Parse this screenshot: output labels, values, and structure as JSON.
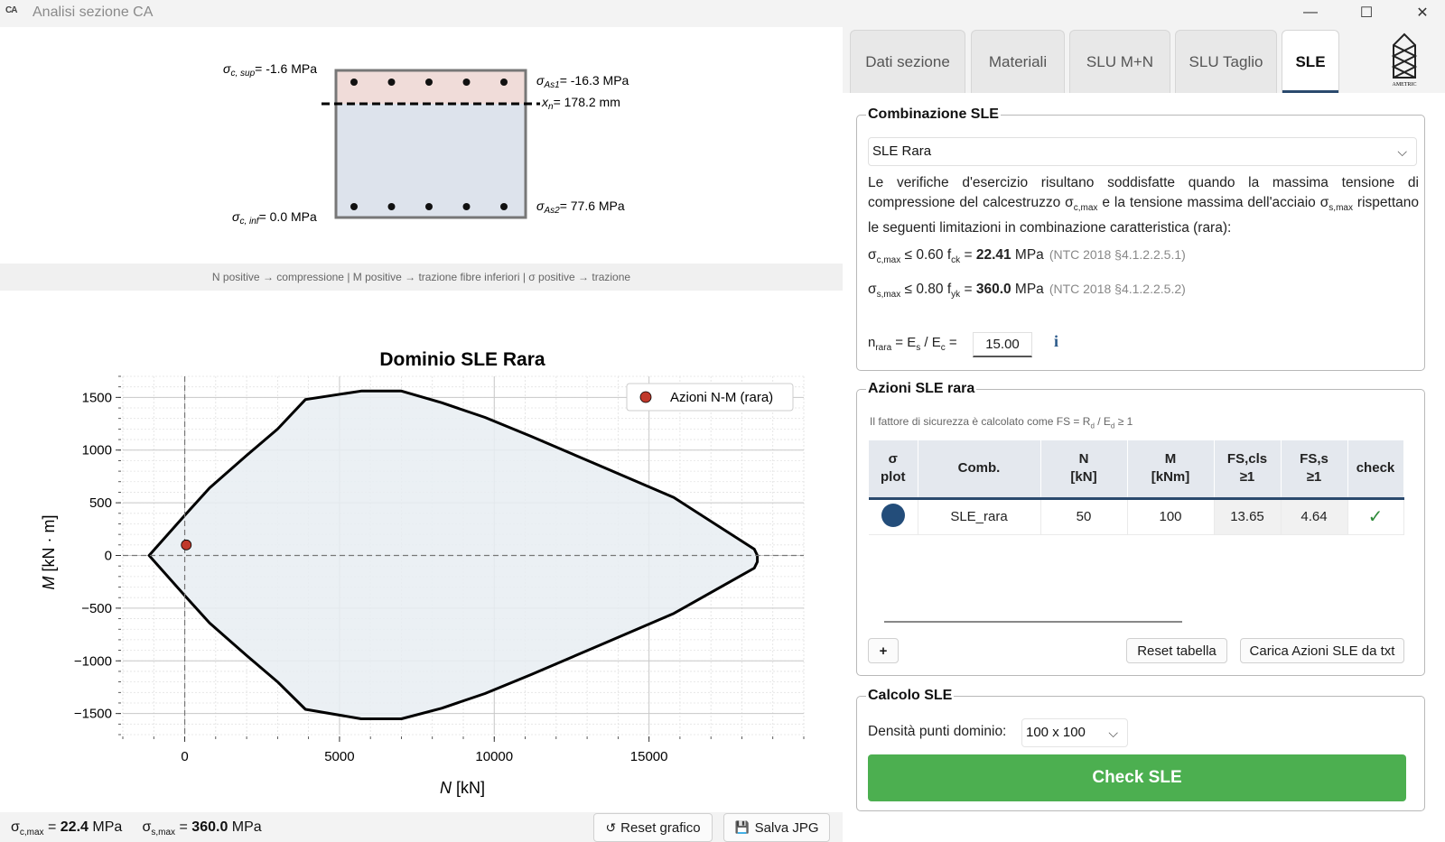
{
  "window": {
    "app_icon": "CA",
    "title": "Analisi sezione CA",
    "minimize": "—",
    "maximize": "☐",
    "close": "✕"
  },
  "section": {
    "sigma_c_sup": "= -1.6 MPa",
    "sigma_c_inf": "= 0.0 MPa",
    "sigma_As1": "= -16.3 MPa",
    "sigma_As2": "= 77.6 MPa",
    "xn": "= 178.2 mm",
    "neutral_axis_depth_fraction": 0.23,
    "top_bars": 5,
    "bottom_bars": 5,
    "colors": {
      "compression": "#f0dcd9",
      "tension": "#dde3ec",
      "border": "#777777"
    }
  },
  "convention": "N positive → compressione  |  M positive → trazione fibre inferiori  |  σ positive → trazione",
  "chart_data": {
    "type": "area",
    "title": "Dominio SLE Rara",
    "xlabel": "N [kN]",
    "ylabel": "M [kN · m]",
    "xlim": [
      -2000,
      20000
    ],
    "ylim": [
      -1700,
      1700
    ],
    "xticks": [
      0,
      5000,
      10000,
      15000
    ],
    "xtick_labels": [
      "0",
      "5000",
      "10000",
      "15000"
    ],
    "yticks": [
      1500,
      1000,
      500,
      0,
      -500,
      -1000,
      -1500
    ],
    "ytick_labels": [
      "1500",
      "1000",
      "500",
      "0",
      "−500",
      "−1000",
      "−1500"
    ],
    "grid": true,
    "legend_position": "top-right",
    "domain_boundary": {
      "x": [
        -1150,
        0,
        800,
        2000,
        3000,
        3900,
        5700,
        7000,
        8300,
        9700,
        11200,
        13500,
        15800,
        18400,
        18500,
        18500,
        18400,
        15800,
        13500,
        11200,
        9700,
        8300,
        7000,
        5700,
        3900,
        3000,
        2000,
        800,
        0,
        -1150
      ],
      "y": [
        0,
        380,
        640,
        950,
        1200,
        1480,
        1560,
        1560,
        1450,
        1310,
        1130,
        840,
        550,
        60,
        0,
        -60,
        -120,
        -550,
        -840,
        -1130,
        -1310,
        -1450,
        -1550,
        -1550,
        -1460,
        -1200,
        -950,
        -640,
        -380,
        0
      ]
    },
    "series": [
      {
        "name": "Azioni N-M (rara)",
        "type": "scatter",
        "points": [
          {
            "x": 50,
            "y": 100
          }
        ]
      }
    ],
    "colors": {
      "fill": "#e8edf2",
      "line": "#000000",
      "point": "#c0392b"
    }
  },
  "status": {
    "sigma_c_label": "σ",
    "sigma_c_sub": "c,max",
    "sigma_c_value": "22.4",
    "sigma_s_label": "σ",
    "sigma_s_sub": "s,max",
    "sigma_s_value": "360.0",
    "unit": "MPa",
    "reset_label": "Reset grafico",
    "reset_icon": "↺",
    "save_label": "Salva JPG",
    "save_icon": "💾"
  },
  "tabs": [
    {
      "label": "Dati sezione",
      "active": false
    },
    {
      "label": "Materiali",
      "active": false
    },
    {
      "label": "SLU M+N",
      "active": false
    },
    {
      "label": "SLU Taglio",
      "active": false
    },
    {
      "label": "SLE",
      "active": true
    }
  ],
  "logo_text": "AMETRIC",
  "combinazione": {
    "title": "Combinazione SLE",
    "selected": "SLE Rara",
    "description_1": "Le verifiche d'esercizio risultano soddisfatte quando la massima tensione di compressione del calcestruzzo σ",
    "description_sub1": "c,max",
    "description_2": " e la tensione massima dell'acciaio σ",
    "description_sub2": "s,max",
    "description_3": " rispettano le seguenti limitazioni in combinazione caratteristica (rara):",
    "lim1_prefix": "σ",
    "lim1_sub": "c,max",
    "lim1_mid": " ≤ 0.60 f",
    "lim1_sub2": "ck",
    "lim1_eq": " = ",
    "lim1_value": "22.41",
    "lim1_unit": " MPa",
    "lim1_ref": "(NTC 2018 §4.1.2.2.5.1)",
    "lim2_prefix": "σ",
    "lim2_sub": "s,max",
    "lim2_mid": " ≤ 0.80 f",
    "lim2_sub2": "yk",
    "lim2_eq": " = ",
    "lim2_value": "360.0",
    "lim2_unit": " MPa",
    "lim2_ref": "(NTC 2018 §4.1.2.2.5.2)",
    "n_label": "n",
    "n_sub": "rara",
    "n_rest": " = E",
    "n_sub_s": "s",
    "n_div": " / E",
    "n_sub_c": "c",
    "n_eq": " =",
    "n_value": "15.00",
    "info_icon": "i"
  },
  "azioni": {
    "title": "Azioni SLE rara",
    "note": "Il fattore di sicurezza è calcolato come FS = R",
    "note_sub1": "d",
    "note_mid": " / E",
    "note_sub2": "d",
    "note_end": " ≥ 1",
    "headers": [
      "σ\nplot",
      "Comb.",
      "N\n[kN]",
      "M\n[kNm]",
      "FS,cls\n≥1",
      "FS,s\n≥1",
      "check"
    ],
    "rows": [
      {
        "comb": "SLE_rara",
        "N": "50",
        "M": "100",
        "FS_cls": "13.65",
        "FS_s": "4.64",
        "check": "✓",
        "color": "#234d7a"
      }
    ],
    "add_label": "+",
    "reset_label": "Reset tabella",
    "load_label": "Carica Azioni SLE da txt"
  },
  "calcolo": {
    "title": "Calcolo SLE",
    "density_label": "Densità punti dominio:",
    "density_value": "100 x 100",
    "check_label": "Check SLE"
  }
}
